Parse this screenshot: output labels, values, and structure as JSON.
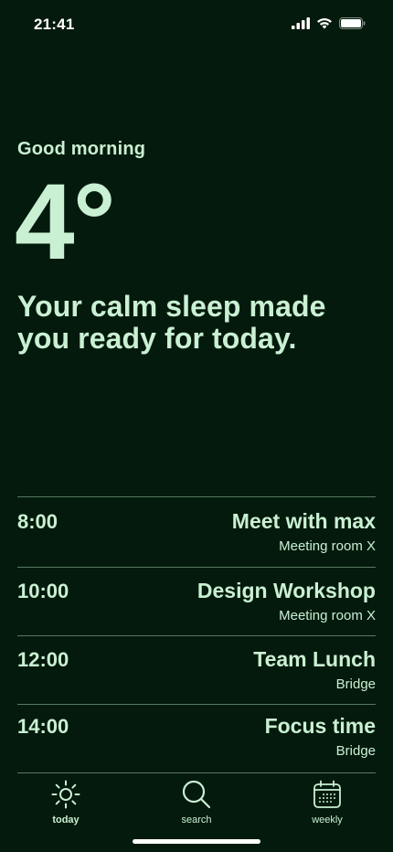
{
  "status_bar": {
    "time": "21:41",
    "icons": [
      "cellular-signal-icon",
      "wifi-icon",
      "battery-icon"
    ]
  },
  "greeting": "Good morning",
  "temperature": "4°",
  "message": "Your calm sleep made you ready for today.",
  "schedule": [
    {
      "time": "8:00",
      "title": "Meet with max",
      "location": "Meeting room X"
    },
    {
      "time": "10:00",
      "title": "Design Workshop",
      "location": "Meeting room X"
    },
    {
      "time": "12:00",
      "title": "Team Lunch",
      "location": "Bridge"
    },
    {
      "time": "14:00",
      "title": "Focus time",
      "location": "Bridge"
    }
  ],
  "tabs": [
    {
      "label": "today",
      "icon": "sun-icon",
      "active": true
    },
    {
      "label": "search",
      "icon": "search-icon",
      "active": false
    },
    {
      "label": "weekly",
      "icon": "calendar-icon",
      "active": false
    }
  ],
  "colors": {
    "background": "#041a0d",
    "accent": "#c9f0d2",
    "divider": "#577a60"
  }
}
